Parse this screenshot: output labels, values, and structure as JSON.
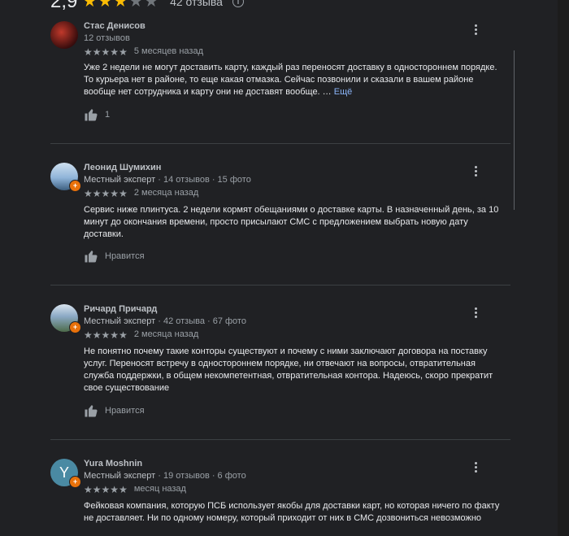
{
  "summary": {
    "rating": "2,9",
    "stars_filled": 3,
    "stars_total": 5,
    "count": "42 отзыва",
    "info_icon": "info-icon"
  },
  "reviews": [
    {
      "name": "Стас Денисов",
      "meta": "12 отзывов",
      "role": "",
      "rating": 5,
      "date": "5 месяцев назад",
      "text": "Уже 2 недели не могут доставить карту, каждый раз переносят доставку в одностороннем порядке. То курьера нет в районе, то еще какая отмазка. Сейчас позвонили и сказали в вашем районе вообще нет сотрудника и карту они не доставят вообще. …",
      "more": "Ещё",
      "likes": "1",
      "avatar_color": "#5a1a1a"
    },
    {
      "name": "Леонид Шумихин",
      "role": "Местный эксперт",
      "meta": " · 14 отзывов · 15 фото",
      "rating": 5,
      "date": "2 месяца назад",
      "text": "Сервис ниже плинтуса. 2 недели кормят обещаниями о доставке карты. В назначенный день, за 10 минут до окончания времени, просто присылают СМС с предложением выбрать новую дату доставки.",
      "likes": "Нравится",
      "avatar_color": "#8fb4d9"
    },
    {
      "name": "Ричард Причард",
      "role": "Местный эксперт",
      "meta": " · 42 отзыва · 67 фото",
      "rating": 5,
      "date": "2 месяца назад",
      "text": "Не понятно почему такие конторы существуют и почему с ними заключают договора на поставку услуг. Переносят встречу в одностороннем порядке, ни отвечают на вопросы, отвратительная служба поддержки, в общем некомпетентная, отвратительная контора. Надеюсь, скоро прекратит свое существование",
      "likes": "Нравится",
      "avatar_color": "#6b8aa8"
    },
    {
      "name": "Yura Moshnin",
      "role": "Местный эксперт",
      "meta": " · 19 отзывов · 6 фото",
      "rating": 5,
      "date": "месяц назад",
      "text": "Фейковая компания, которую ПСБ использует якобы для доставки карт, но которая ничего по факту не доставляет. Ни по одному номеру, который приходит от них в СМС дозвониться невозможно",
      "avatar_letter": "Y",
      "avatar_color": "#4a8aa3"
    }
  ]
}
